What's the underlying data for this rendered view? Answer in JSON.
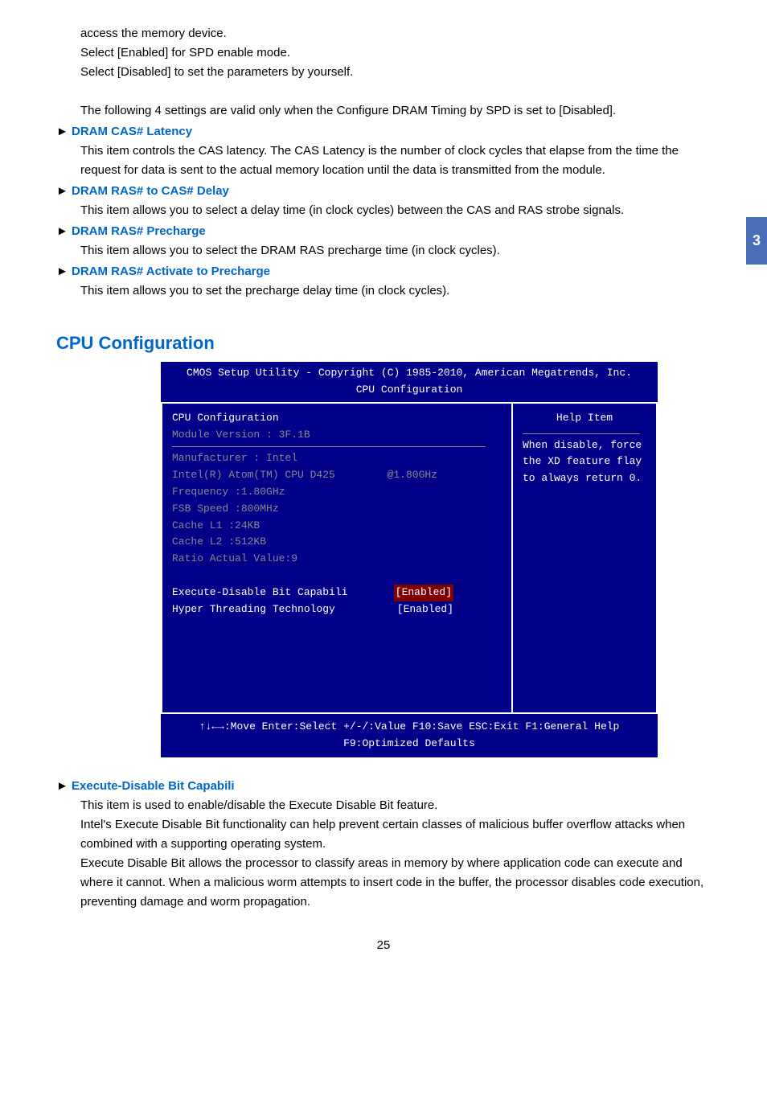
{
  "sideBadge": "3",
  "intro": {
    "line1": "access the memory device.",
    "line2": "Select [Enabled] for SPD enable mode.",
    "line3": "Select [Disabled] to set the parameters by yourself.",
    "line4": "The following 4 settings are valid only when the Configure DRAM Timing by SPD is set to [Disabled]."
  },
  "sections": {
    "casLatency": {
      "title": "DRAM CAS# Latency",
      "body": "This item controls the CAS latency. The CAS Latency is the number of clock cycles that elapse from the time the request for data is sent to the actual memory location until the data is transmitted from the module."
    },
    "rasToCas": {
      "title": "DRAM RAS# to CAS# Delay",
      "body": "This item allows you to select a delay time (in clock cycles) between the CAS and RAS strobe signals."
    },
    "rasPrecharge": {
      "title": "DRAM RAS# Precharge",
      "body": "This item allows you to select the DRAM RAS precharge time (in clock cycles)."
    },
    "rasActivate": {
      "title": "DRAM RAS# Activate to Precharge",
      "body": "This item allows you to set the precharge delay time (in clock cycles)."
    }
  },
  "cpuHeading": "CPU Configuration",
  "bios": {
    "titleLine1": "CMOS Setup Utility - Copyright (C) 1985-2010, American Megatrends, Inc.",
    "titleLine2": "CPU Configuration",
    "cpuConfigLabel": "CPU Configuration",
    "moduleVersion": "Module Version :  3F.1B",
    "manufacturer": "Manufacturer : Intel",
    "cpuModel": "Intel(R) Atom(TM) CPU  D425",
    "cpuSpeed": "@1.80GHz",
    "frequency": "Frequency      :1.80GHz",
    "fsbSpeed": "FSB Speed    :800MHz",
    "cacheL1": "Cache L1       :24KB",
    "cacheL2": "Cache L2       :512KB",
    "ratio": "Ratio Actual Value:9",
    "execDisable": "Execute-Disable Bit Capabili",
    "execDisableVal": "[Enabled]",
    "hyperThreading": "Hyper Threading Technology",
    "hyperThreadingVal": "[Enabled]",
    "helpItem": "Help Item",
    "helpText": "When disable, force the XD feature flay to always return 0.",
    "footer": "↑↓←→:Move   Enter:Select     +/-/:Value     F10:Save      ESC:Exit     F1:General Help",
    "footerLine2": "F9:Optimized Defaults"
  },
  "execBit": {
    "title": "Execute-Disable Bit Capabili",
    "body1": "This item is used to enable/disable the Execute Disable Bit feature.",
    "body2": "Intel's Execute Disable Bit functionality can help prevent certain classes of malicious buffer overflow attacks when combined with a supporting operating system.",
    "body3": "Execute Disable Bit allows the processor to classify areas in memory by where application code can execute and where it cannot. When a malicious worm attempts to insert code in the buffer, the processor disables code execution, preventing damage and worm propagation."
  },
  "pageNum": "25"
}
